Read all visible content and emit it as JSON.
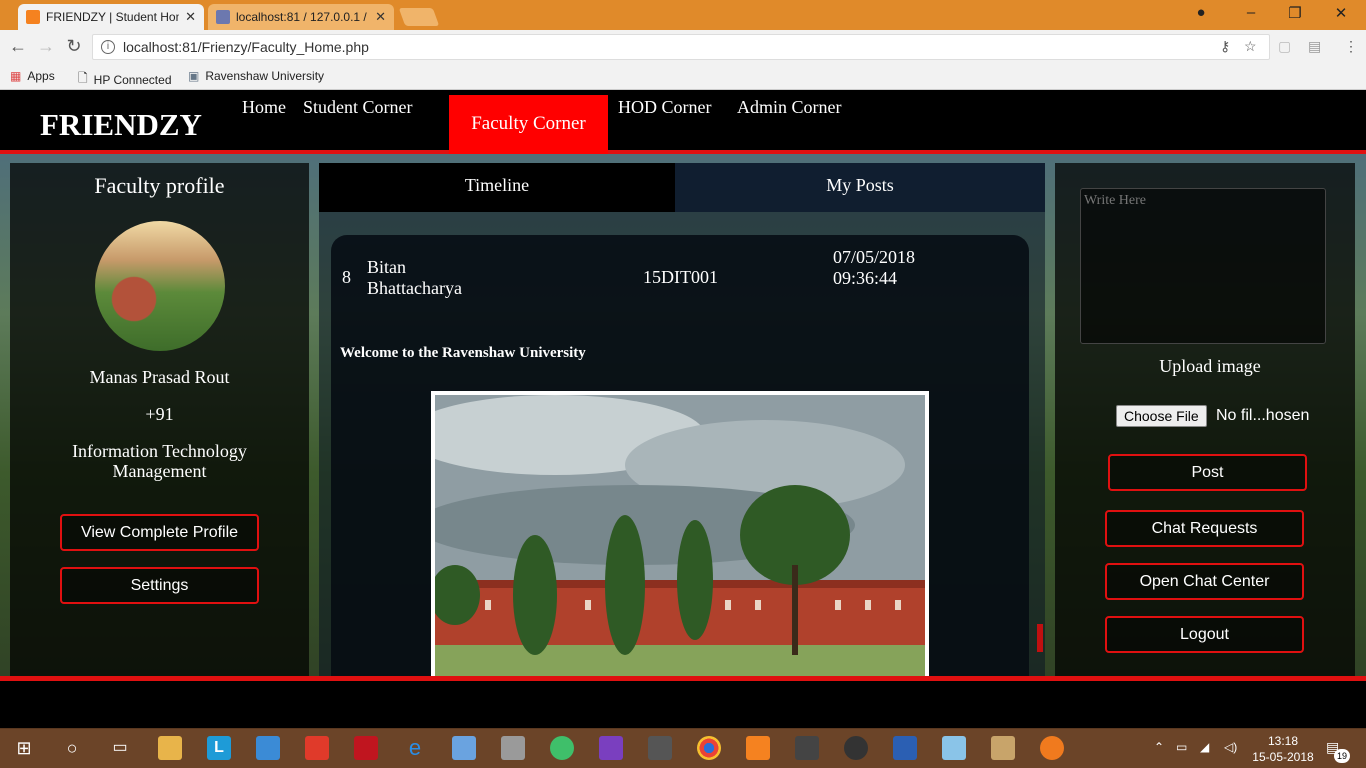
{
  "browser": {
    "tabs": [
      {
        "title": "FRIENDZY | Student Hom",
        "active": true
      },
      {
        "title": "localhost:81 / 127.0.0.1 /",
        "active": false
      }
    ],
    "url": "localhost:81/Frienzy/Faculty_Home.php",
    "bookmarks": [
      "Apps",
      "HP Connected",
      "Ravenshaw University"
    ]
  },
  "site": {
    "brand": "FRIENDZY",
    "nav": [
      "Home",
      "Student Corner",
      "Faculty Corner",
      "HOD Corner",
      "Admin Corner"
    ],
    "active_nav": "Faculty Corner"
  },
  "profile": {
    "title": "Faculty profile",
    "name": "Manas Prasad Rout",
    "phone": "+91",
    "department_line1": "Information Technology",
    "department_line2": "Management",
    "view_profile_label": "View Complete Profile",
    "settings_label": "Settings"
  },
  "feed": {
    "tabs": [
      "Timeline",
      "My Posts"
    ],
    "post": {
      "number": "8",
      "author_line1": "Bitan",
      "author_line2": "Bhattacharya",
      "user_id": "15DIT001",
      "date": "07/05/2018",
      "time": "09:36:44",
      "body": "Welcome to the Ravenshaw University"
    }
  },
  "composer": {
    "placeholder": "Write Here",
    "upload_label": "Upload image",
    "choose_file_label": "Choose File",
    "file_status": "No fil...hosen",
    "post_label": "Post",
    "chat_requests_label": "Chat Requests",
    "chat_center_label": "Open Chat Center",
    "logout_label": "Logout"
  },
  "taskbar": {
    "time": "13:18",
    "date": "15-05-2018",
    "notifications": "19"
  }
}
